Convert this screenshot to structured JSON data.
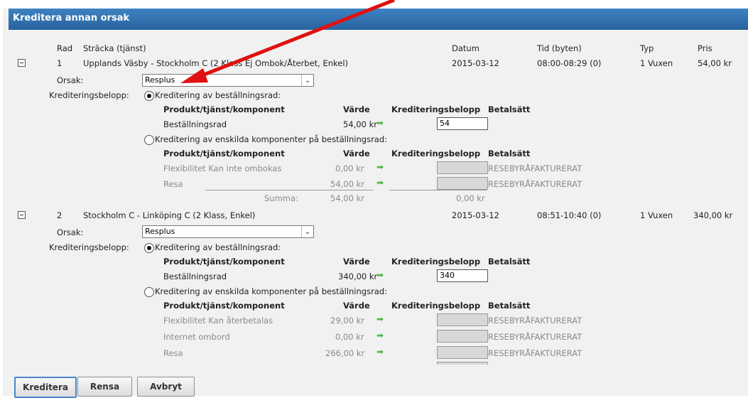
{
  "dialog_title": "Kreditera annan orsak",
  "columns": {
    "rad": "Rad",
    "stracka": "Sträcka (tjänst)",
    "datum": "Datum",
    "tid": "Tid (byten)",
    "typ": "Typ",
    "pris": "Pris"
  },
  "labels": {
    "orsak": "Orsak:",
    "krediteringsbelopp": "Krediteringsbelopp:",
    "opt_row": "Kreditering av beställningsrad:",
    "opt_components": "Kreditering av enskilda komponenter på beställningsrad:",
    "col_produkt": "Produkt/tjänst/komponent",
    "col_varde": "Värde",
    "col_kredit": "Krediteringsbelopp",
    "col_betalsatt": "Betalsätt",
    "bestallningsrad": "Beställningsrad",
    "summa": "Summa:"
  },
  "rows": [
    {
      "rad": "1",
      "stracka": "Upplands Väsby - Stockholm C  (2 Klass Ej Ombok/Återbet, Enkel)",
      "datum": "2015-03-12",
      "tid": "08:00-08:29 (0)",
      "typ": "1 Vuxen",
      "pris": "54,00 kr",
      "orsak": "Resplus",
      "row_value": "54,00 kr",
      "row_credit": "54",
      "components": [
        {
          "name": "Flexibilitet Kan inte ombokas",
          "value": "0,00 kr",
          "betalsatt": "RESEBYRÅFAKTURERAT"
        },
        {
          "name": "Resa",
          "value": "54,00 kr",
          "betalsatt": "RESEBYRÅFAKTURERAT"
        }
      ],
      "summa_value": "54,00 kr",
      "summa_credit": "0,00 kr"
    },
    {
      "rad": "2",
      "stracka": "Stockholm C - Linköping C  (2 Klass, Enkel)",
      "datum": "2015-03-12",
      "tid": "08:51-10:40 (0)",
      "typ": "1 Vuxen",
      "pris": "340,00 kr",
      "orsak": "Resplus",
      "row_value": "340,00 kr",
      "row_credit": "340",
      "components": [
        {
          "name": "Flexibilitet Kan återbetalas",
          "value": "29,00 kr",
          "betalsatt": "RESEBYRÅFAKTURERAT"
        },
        {
          "name": "Internet ombord",
          "value": "0,00 kr",
          "betalsatt": "RESEBYRÅFAKTURERAT"
        },
        {
          "name": "Resa",
          "value": "266,00 kr",
          "betalsatt": "RESEBYRÅFAKTURERAT"
        }
      ]
    }
  ],
  "buttons": {
    "kreditera": "Kreditera",
    "rensa": "Rensa",
    "avbryt": "Avbryt"
  },
  "icons": {
    "expander": "collapse-minus-icon",
    "value_arrow": "green-right-arrow-icon",
    "annotation": "red-annotation-arrow"
  },
  "colors": {
    "titlebar": "#2f6fae",
    "annotation_arrow": "#e01010",
    "value_arrow": "#4cb847"
  }
}
